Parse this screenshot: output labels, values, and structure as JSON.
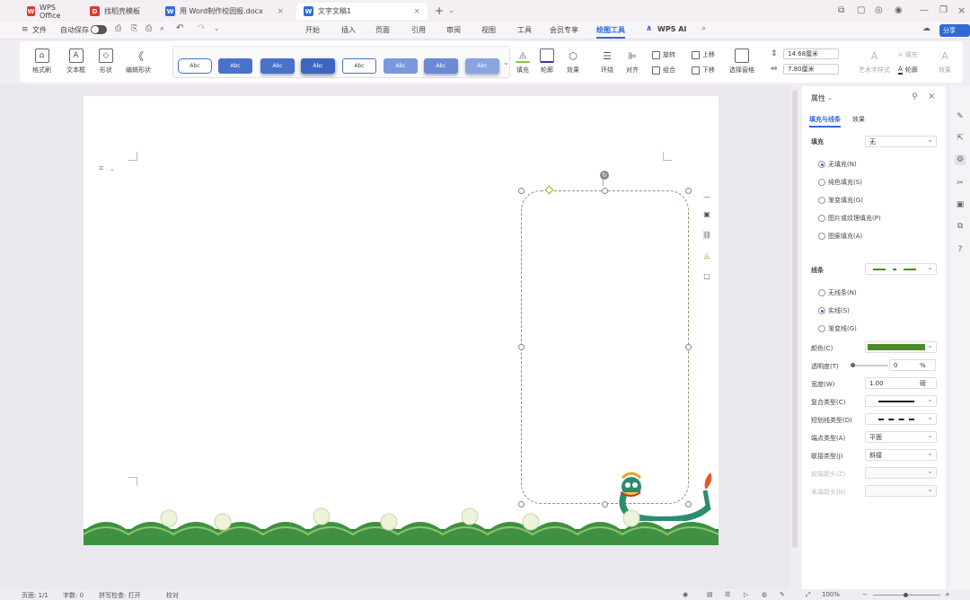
{
  "tabs": [
    {
      "label": "WPS Office",
      "icon": "wps-logo-icon",
      "color": "#e2352c"
    },
    {
      "label": "找稻壳模板",
      "icon": "docer-icon",
      "color": "#e2352c"
    },
    {
      "label": "用 Word制作校园报.docx",
      "icon": "word-doc-icon",
      "color": "#2f6bd8"
    },
    {
      "label": "文字文稿1",
      "icon": "word-doc-icon",
      "color": "#2f6bd8"
    }
  ],
  "menu": {
    "file": "文件",
    "autosave": "自动保存",
    "items": [
      "开始",
      "插入",
      "页面",
      "引用",
      "审阅",
      "视图",
      "工具",
      "会员专享",
      "绘图工具"
    ],
    "wps_ai": "WPS AI",
    "share": "分享"
  },
  "ribbon": {
    "format_painter": "格式刷",
    "textbox": "文本框",
    "shape": "形状",
    "edit_shape": "编辑形状",
    "style_label": "Abc",
    "fill": "填充",
    "outline": "轮廓",
    "effect": "效果",
    "wrap": "环绕",
    "align": "对齐",
    "rotate": "旋转",
    "group": "组合",
    "up": "上移",
    "down": "下移",
    "select_pane": "选择窗格",
    "height": "14.68厘米",
    "width": "7.80厘米",
    "art_text": "艺术字样式",
    "text_outline": "轮廓",
    "text_fill": "填充",
    "text_effect": "效果"
  },
  "panel": {
    "title": "属性",
    "tab_fill_line": "填充与线条",
    "tab_effect": "效果",
    "fill_section": "填充",
    "fill_value": "无",
    "fill_options": [
      "无填充(N)",
      "纯色填充(S)",
      "渐变填充(G)",
      "图片或纹理填充(P)",
      "图案填充(A)"
    ],
    "line_section": "线条",
    "line_options": [
      "无线条(N)",
      "实线(S)",
      "渐变线(G)"
    ],
    "color_label": "颜色(C)",
    "line_color": "#4e8a2c",
    "transparency_label": "透明度(T)",
    "transparency_value": "0",
    "transparency_unit": "%",
    "width_label": "宽度(W)",
    "width_value": "1.00",
    "width_unit": "磅",
    "compound_label": "复合类型(C)",
    "dash_label": "短划线类型(D)",
    "cap_label": "端点类型(A)",
    "cap_value": "平面",
    "join_label": "联接类型(J)",
    "join_value": "斜接",
    "begin_arrow_label": "前端箭头(Z)",
    "end_arrow_label": "末端箭头(N)"
  },
  "status": {
    "page": "页面: 1/1",
    "words": "字数: 0",
    "spell": "拼写检查: 打开",
    "proof": "校对",
    "zoom": "100%"
  }
}
